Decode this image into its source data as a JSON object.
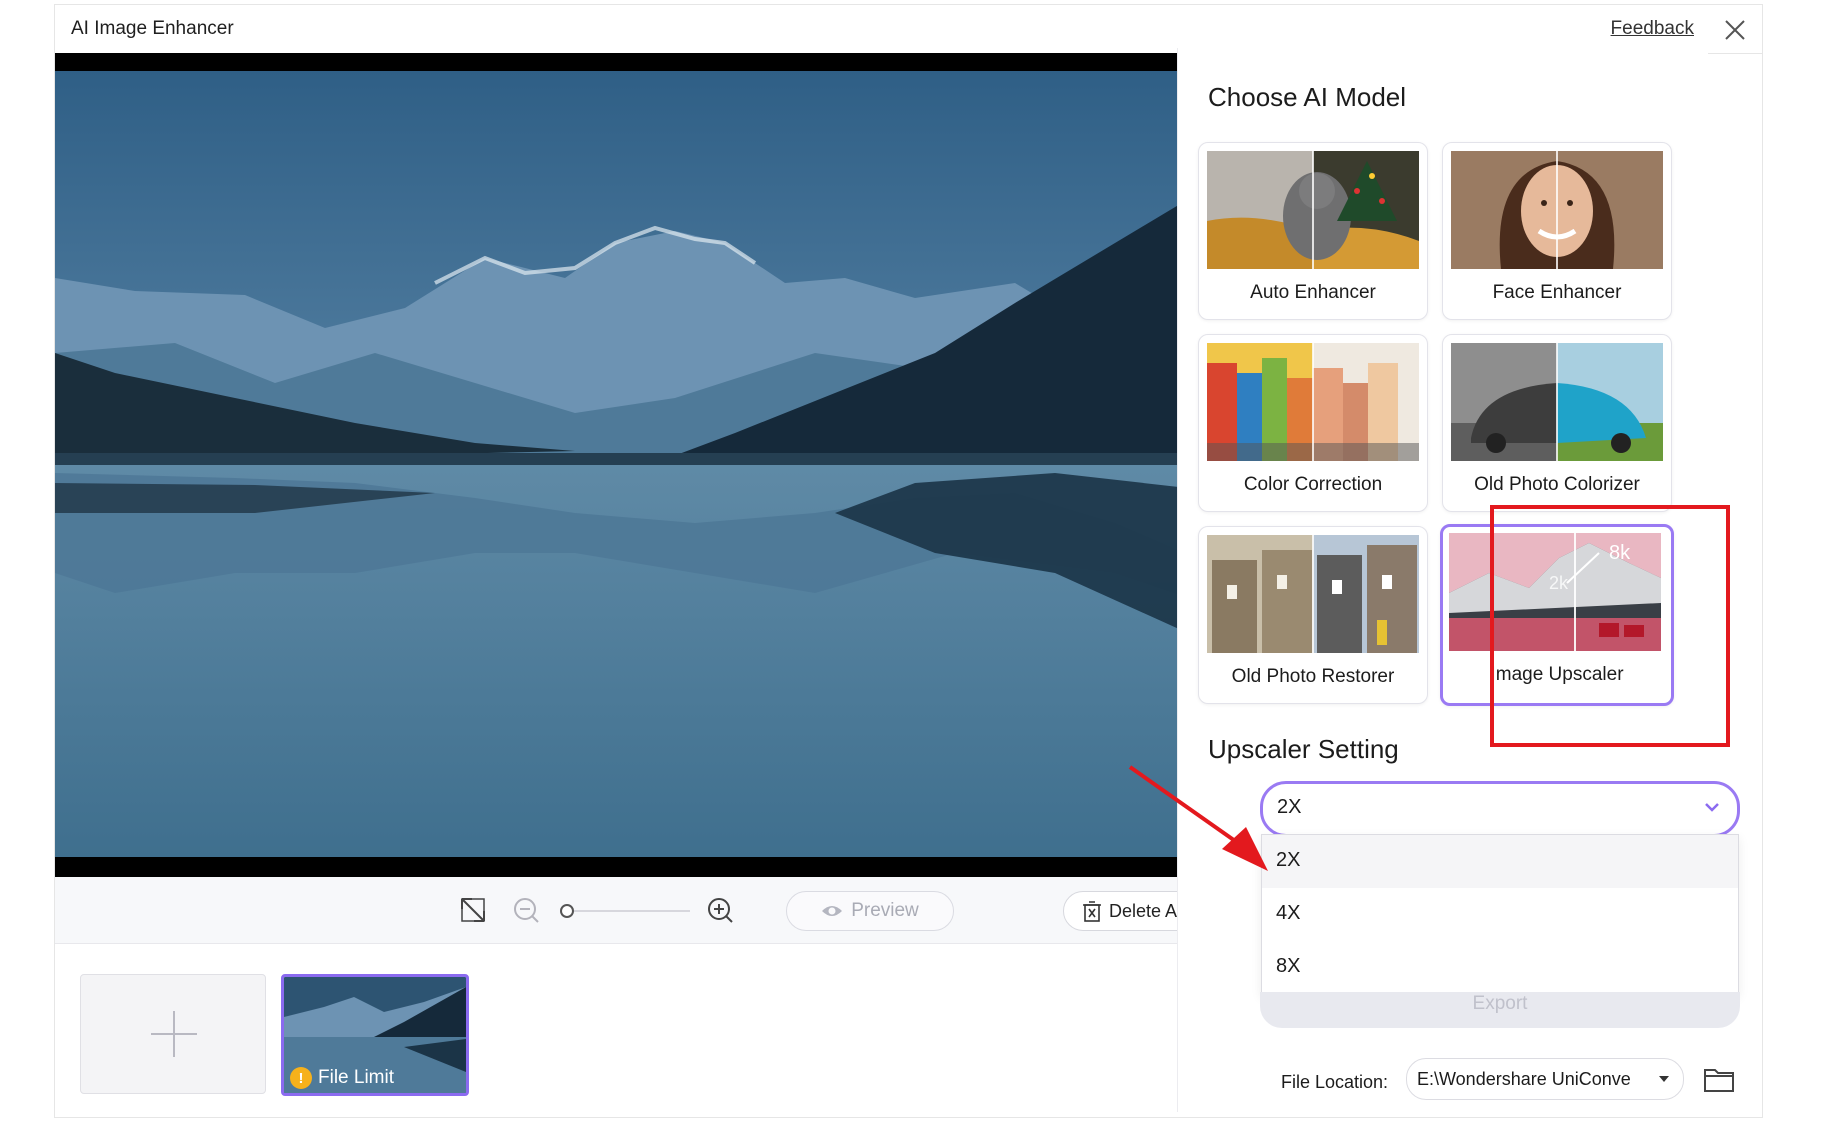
{
  "window": {
    "title": "AI Image Enhancer",
    "feedback_label": "Feedback"
  },
  "toolbar": {
    "preview_label": "Preview",
    "delete_all_label": "Delete All"
  },
  "thumbnails": {
    "file_limit_label": "File Limit"
  },
  "panel": {
    "choose_model_heading": "Choose AI Model",
    "models": [
      {
        "label": "Auto Enhancer",
        "selected": false
      },
      {
        "label": "Face Enhancer",
        "selected": false
      },
      {
        "label": "Color Correction",
        "selected": false
      },
      {
        "label": "Old Photo Colorizer",
        "selected": false
      },
      {
        "label": "Old Photo Restorer",
        "selected": false
      },
      {
        "label": "Image Upscaler",
        "selected": true,
        "badges": [
          "8k",
          "2k"
        ]
      }
    ],
    "upscaler_heading": "Upscaler Setting",
    "upscaler_value": "2X",
    "upscaler_options": [
      "2X",
      "4X",
      "8X"
    ],
    "export_label": "Export",
    "file_location_label": "File Location:",
    "file_location_value": "E:\\Wondershare UniConve"
  },
  "colors": {
    "accent": "#9a7af3",
    "highlight": "#e3191e"
  }
}
